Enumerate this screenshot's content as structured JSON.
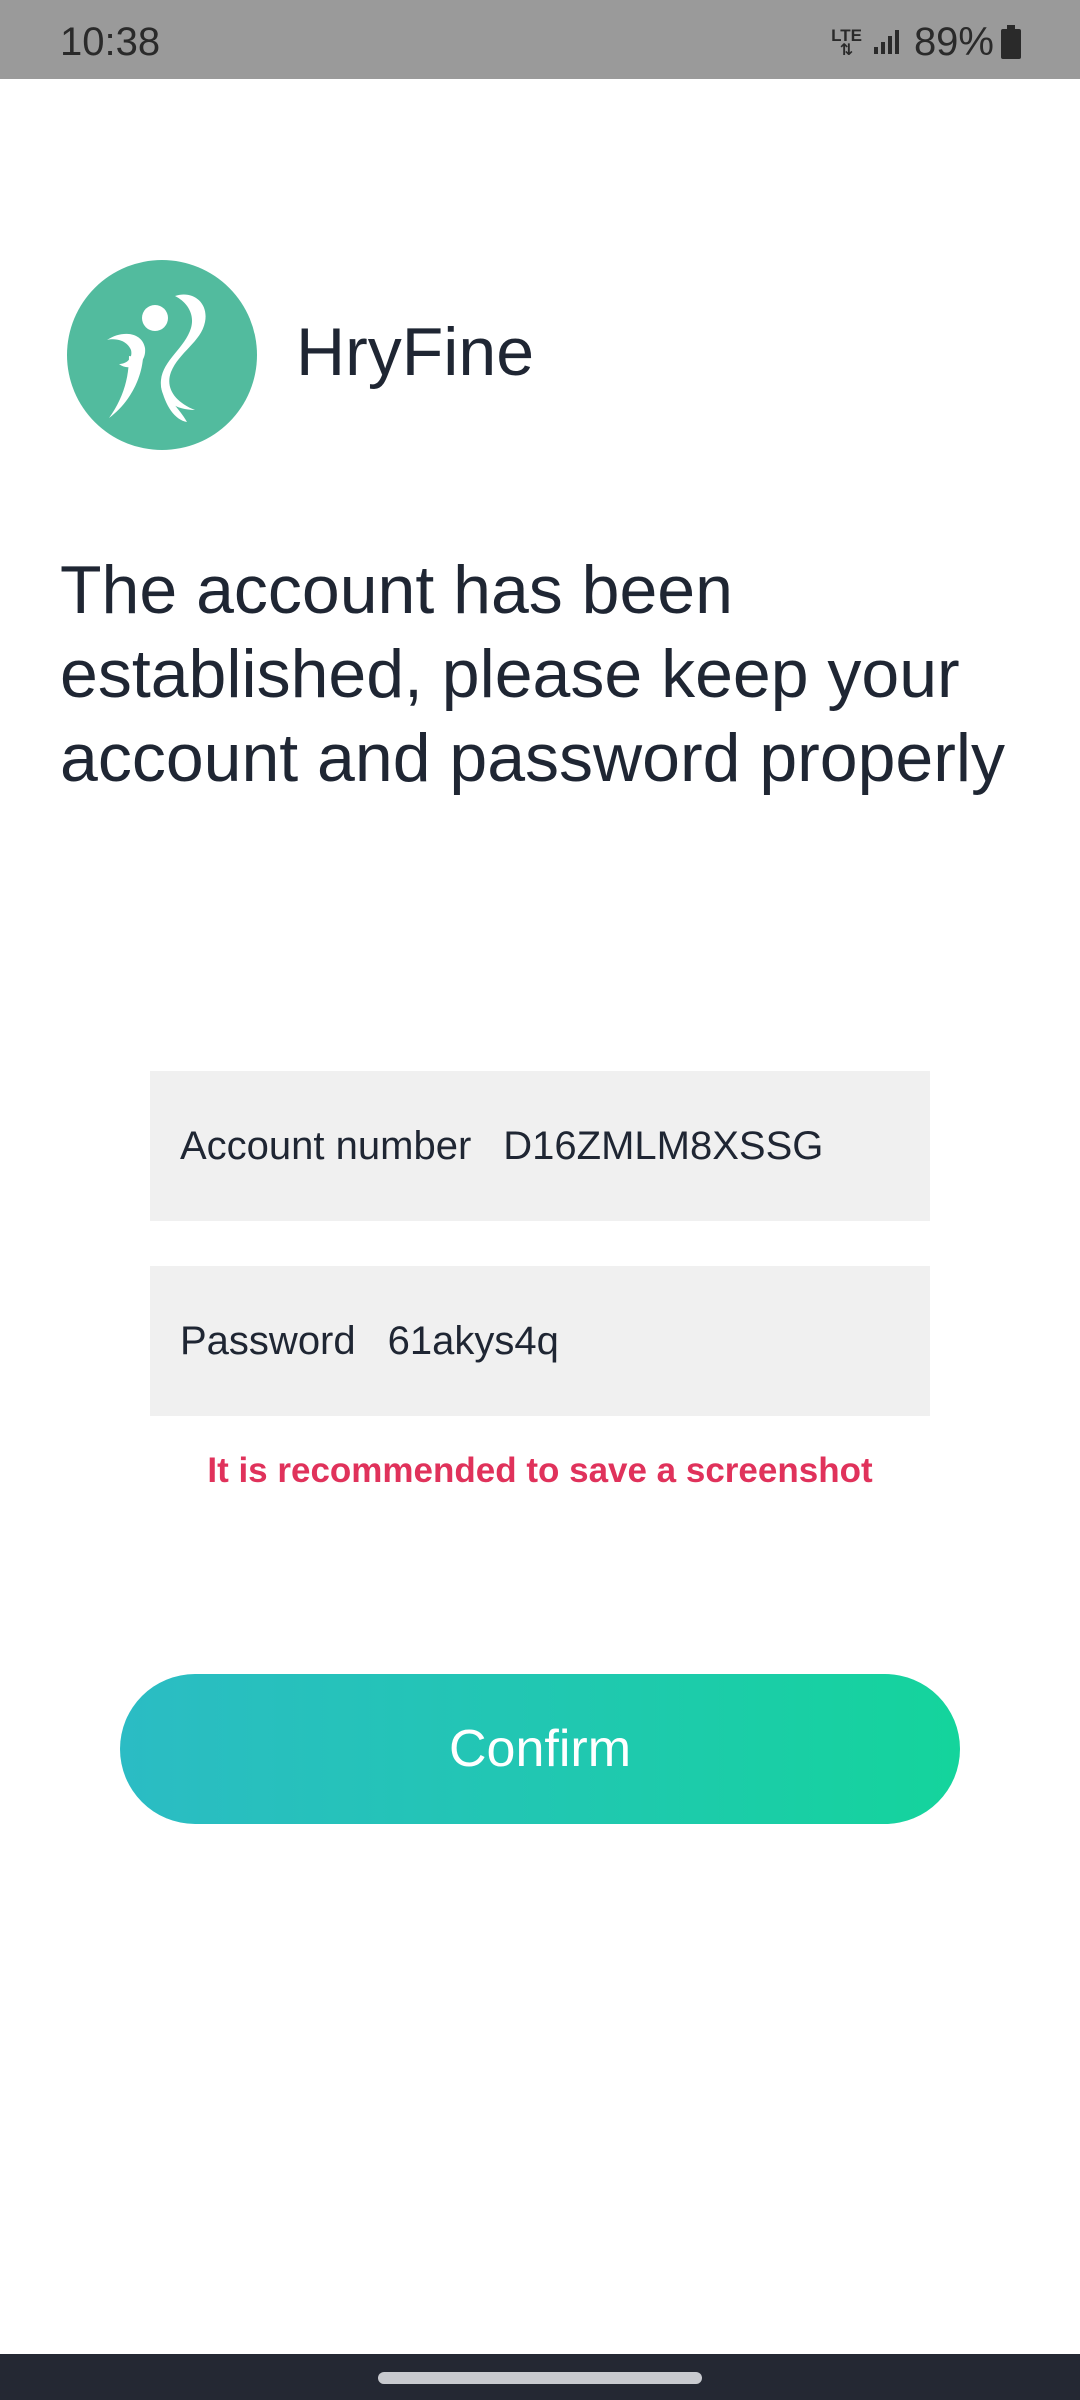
{
  "status_bar": {
    "time": "10:38",
    "network": "LTE",
    "battery_percent": "89%",
    "icons": [
      "lte-icon",
      "signal-icon",
      "battery-icon"
    ]
  },
  "header": {
    "app_name": "HryFine",
    "logo_icon": "hryfine-logo-icon",
    "logo_color": "#52bb9e"
  },
  "message": {
    "headline": "The account has been established, please keep your account and password properly"
  },
  "account": {
    "label": "Account number",
    "value": "D16ZMLM8XSSG"
  },
  "password": {
    "label": "Password",
    "value": "61akys4q"
  },
  "hint": {
    "text": "It is recommended to save a screenshot",
    "color": "#e0325b"
  },
  "actions": {
    "confirm_label": "Confirm",
    "gradient_start": "#2bbcc4",
    "gradient_end": "#14d49c"
  },
  "nav": {
    "handle_icon": "home-handle-icon"
  }
}
